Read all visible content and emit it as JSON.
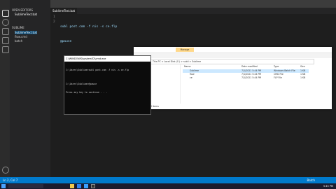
{
  "editor": {
    "tab_active": "SublimeText.bat",
    "tab_2": "",
    "tab_3": "",
    "line_numbers": [
      "1",
      "2"
    ],
    "code_lines": [
      "subl post.com -f nis -s ce.flp",
      "@pause"
    ]
  },
  "sidebar": {
    "items": [
      {
        "label": "OPEN EDITORS"
      },
      {
        "label": "SublimeText.bat"
      },
      {
        "label": "SUBLIME"
      },
      {
        "label": "SublimeText.bat"
      },
      {
        "label": "flow.cmd"
      },
      {
        "label": "batch"
      }
    ]
  },
  "cmd": {
    "title": "C:\\WINDOWS\\system32\\cmd.exe",
    "lines": [
      "C:\\Users\\Sublime>subl post.com -f nis -s ce.flp",
      "",
      "C:\\Users\\Sublime>@pause",
      "Press any key to continue . . ."
    ]
  },
  "explorer": {
    "ribbon_tab": "Manage",
    "path": "This PC  >  Local Disk (C:)  >  subli  >  Sublime",
    "columns": [
      "Name",
      "Date modified",
      "Type",
      "Size"
    ],
    "rows": [
      {
        "name": "Sublime",
        "date": "7/1/2021 5:44 PM",
        "type": "Windows Batch File",
        "size": "1 KB"
      },
      {
        "name": "flow",
        "date": "7/1/2021 5:44 PM",
        "type": "CMD File",
        "size": "1 KB"
      },
      {
        "name": "ce",
        "date": "7/1/2021 5:44 PM",
        "type": "FLP File",
        "size": "1 KB"
      }
    ],
    "status": "3 items"
  },
  "statusbar": {
    "left": "Ln 2, Col 7",
    "right": "Batch"
  },
  "taskbar": {
    "clock": "5:45 PM"
  },
  "colors": {
    "accent": "#007acc",
    "ribbon": "#ffd88a"
  }
}
